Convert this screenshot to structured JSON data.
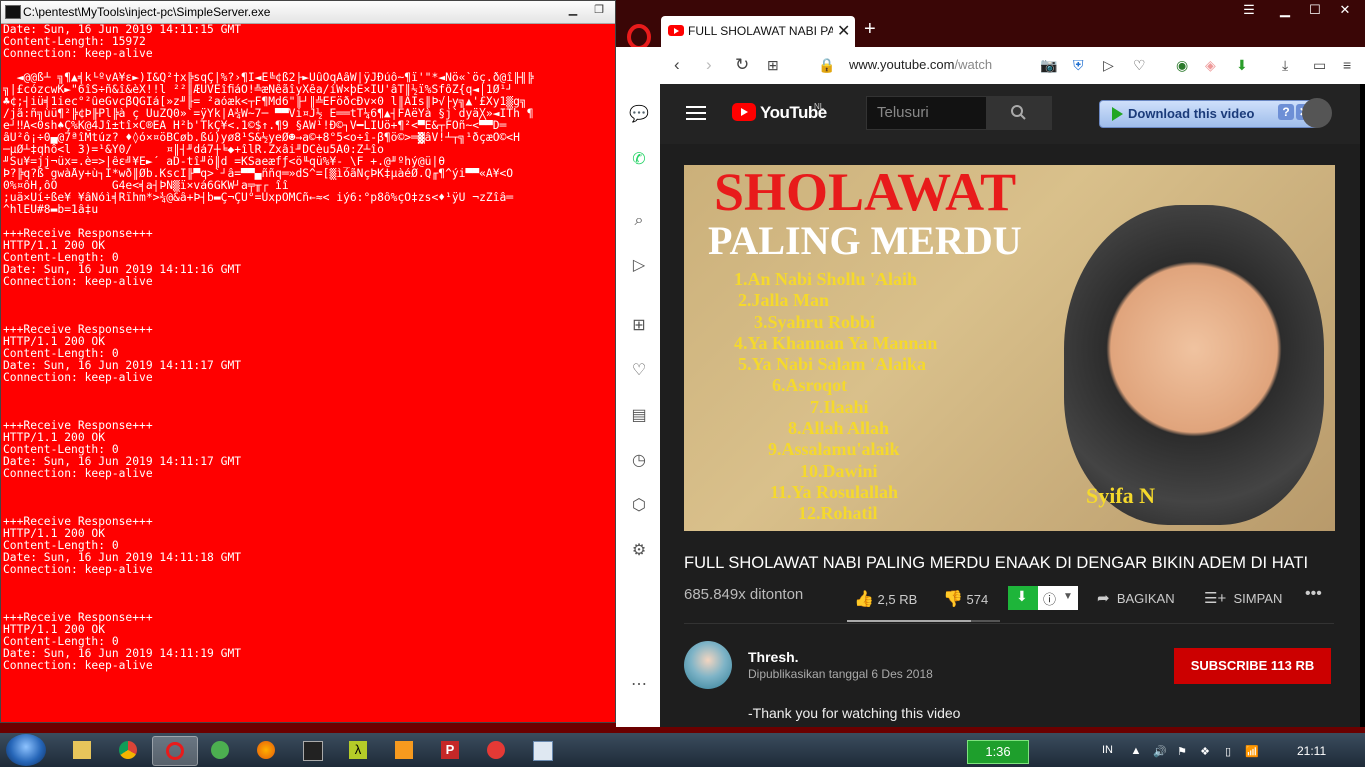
{
  "console": {
    "title": "C:\\pentest\\MyTools\\inject-pc\\SimpleServer.exe",
    "lines": [
      "Date: Sun, 16 Jun 2019 14:11:15 GMT",
      "Content-Length: 15972",
      "Connection: keep-alive",
      "",
      "  ◄@@ß┴ ╗¶▲╡k└ºvA¥ε►)I&Q²†x╠sqÇ|%?›¶I◄E╚¢ß2├►ÜûÔqAâW|ÿJÐúô~¶ï'\"*◄Ñö«`öç.ð@î╟╢╠",
      "╗|£cózcwK►\"6îS÷ñ&î&èX!!l ²²║ÆUVÊîﬁáÔ!╩æNêãîyXêa/íW×þE×IU'âT║½ï%SfôZ{q◄│1Ø¹┘",
      "♣¢;┤iü╡1iec°²ûeGvcβQGIá[»z╜╟= ²aóæk<┬F¶Md6\"╟┘║╩EFöðcÐv×0 l║ÄIs║Þ√├y╗▲'£Xy1▒g╗",
      "/jã:ñ╗ùü¶²╠¢Þ╟Pl╠à ç ÜuZQ0»`=ÿYk|A¾W~7─ ▀▀Vi¤J½ E══tT¼6¶▲┤FAëYà §j`dyä╳»◄ÍTh ¶",
      "e┘‼Ã<0sh♠Ç%K@4Jî±tî×C®ÉA H²b'TkÇ¥<.1©$↑.¶9 §AW¹!Ð©┐V━LIÜö+¶²<▀E&┬FOñ~<▀▀D═",
      "âU²ô¡÷0▄@7ªîMtúz? ♦◊ó×¤öBCøb.ßú)yø8¹Š&½yeØ☻→a©+8°5<o÷î-β¶ö©>═▓âV!┴┬╗¹ðçæO©<H",
      "─µØ┴‡qhô<l 3)=¹&Ý0/     ¤║┤╜dá7┼╘◆+îlR.Zxâi╜DCèu5A0:Z┴îo",
      "╜Su¥=jj¬üx=.è=>|êε╝¥Ë►´ aD-tî╜ö║d =KSaeæfƒ<ö╙qü%¥-_\\F +.@╜ºhý@ü|θ",
      "Þ?╠q?ß¯gwàÅy+ù┐I*wð║Øb.KscI╟▀q>`┘â=▀▀▄ññq═»dS^=[▒ìóãNçÞK‡µàéØ.Q╓¶^ýi▀▀«A¥<O",
      "0%¤ôH,ôO        G4e<╡a┤ÞN▒ï×vá6GKW┘a╤╥┌ îî",
      ";uä×Uí÷ße¥ ¥âNóì╡Rïhm*>¾@&â+Þ┤b▬Ç¬ÇU°=UxpÔMCñ←≈< iý6:°p8ô%çO‡zs<♦¹ÿU ¬zZîâ═",
      "^hlEU#8▬b=1â‡u",
      "",
      "+++Receive Response+++",
      "HTTP/1.1 200 OK",
      "Content-Length: 0",
      "Date: Sun, 16 Jun 2019 14:11:16 GMT",
      "Connection: keep-alive",
      "",
      "",
      "",
      "+++Receive Response+++",
      "HTTP/1.1 200 OK",
      "Content-Length: 0",
      "Date: Sun, 16 Jun 2019 14:11:17 GMT",
      "Connection: keep-alive",
      "",
      "",
      "",
      "+++Receive Response+++",
      "HTTP/1.1 200 OK",
      "Content-Length: 0",
      "Date: Sun, 16 Jun 2019 14:11:17 GMT",
      "Connection: keep-alive",
      "",
      "",
      "",
      "+++Receive Response+++",
      "HTTP/1.1 200 OK",
      "Content-Length: 0",
      "Date: Sun, 16 Jun 2019 14:11:18 GMT",
      "Connection: keep-alive",
      "",
      "",
      "",
      "+++Receive Response+++",
      "HTTP/1.1 200 OK",
      "Content-Length: 0",
      "Date: Sun, 16 Jun 2019 14:11:19 GMT",
      "Connection: keep-alive"
    ]
  },
  "browser": {
    "tab_title": "FULL SHOLAWAT NABI PAL",
    "url_host": "www.youtube.com",
    "url_path": "/watch"
  },
  "youtube": {
    "brand": "YouTube",
    "region": "NL",
    "search_placeholder": "Telusuri",
    "download_label": "Download this video",
    "thumbnail": {
      "line1": "SHOLAWAT",
      "line2": "PALING MERDU",
      "tracks": [
        "1.An Nabi Shollu 'Alaih",
        "2.Jalla Man",
        "3.Syahru Robbi",
        "4.Ya Khannan Ya Mannan",
        "5.Ya Nabi Salam 'Alaika",
        "6.Asroqot",
        "7.Ilaahi",
        "8.Allah Allah",
        "9.Assalamu'alaik",
        "10.Dawini",
        "11.Ya Rosulallah",
        "12.Rohatil"
      ],
      "signature": "Syifa N"
    },
    "video_title": "FULL SHOLAWAT NABI PALING MERDU ENAAK DI DENGAR BIKIN ADEM DI HATI",
    "views": "685.849x ditonton",
    "likes": "2,5 RB",
    "dislikes": "574",
    "like_ratio": 0.81,
    "share": "BAGIKAN",
    "save": "SIMPAN",
    "channel": "Thresh.",
    "published": "Dipublikasikan tanggal 6 Des 2018",
    "subscribe": "SUBSCRIBE  113 RB",
    "description": "-Thank you for watching this video"
  },
  "taskbar": {
    "clock_box": "1:36",
    "lang": "IN",
    "time": "21:11"
  }
}
